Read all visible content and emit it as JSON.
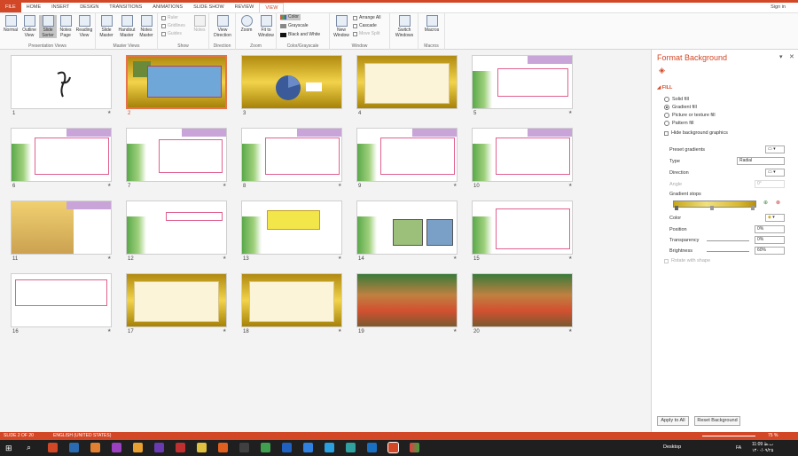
{
  "tabs": [
    "FILE",
    "HOME",
    "INSERT",
    "DESIGN",
    "TRANSITIONS",
    "ANIMATIONS",
    "SLIDE SHOW",
    "REVIEW",
    "VIEW"
  ],
  "signin": "Sign in",
  "ribbon": {
    "presentation_views": [
      "Normal",
      "Outline View",
      "Slide Sorter",
      "Notes Page",
      "Reading View"
    ],
    "presentation_views_label": "Presentation Views",
    "master_views": [
      "Slide Master",
      "Handout Master",
      "Notes Master"
    ],
    "master_views_label": "Master Views",
    "show": [
      "Ruler",
      "Gridlines",
      "Guides"
    ],
    "notes": "Notes",
    "show_label": "Show",
    "view_direction": "View Direction",
    "direction_label": "Direction",
    "zoom": "Zoom",
    "fit_to_window": "Fit to Window",
    "zoom_label": "Zoom",
    "color_opts": [
      "Color",
      "Grayscale",
      "Black and White"
    ],
    "color_label": "Color/Grayscale",
    "new_window": "New Window",
    "window_opts": [
      "Arrange All",
      "Cascade",
      "Move Split"
    ],
    "switch_windows": "Switch Windows",
    "window_label": "Window",
    "macros": "Macros",
    "macros_label": "Macros"
  },
  "slides": [
    "1",
    "2",
    "3",
    "4",
    "5",
    "6",
    "7",
    "8",
    "9",
    "10",
    "11",
    "12",
    "13",
    "14",
    "15",
    "16",
    "17",
    "18",
    "19",
    "20"
  ],
  "selected_slide": 2,
  "pane": {
    "title": "Format Background",
    "fill_section": "FILL",
    "fill_opts": [
      "Solid fill",
      "Gradient fill",
      "Picture or texture fill",
      "Pattern fill"
    ],
    "selected_fill": "Gradient fill",
    "hide_bg": "Hide background graphics",
    "preset": "Preset gradients",
    "type_label": "Type",
    "type_value": "Radial",
    "direction": "Direction",
    "angle": "Angle",
    "angle_value": "0°",
    "gradient_stops": "Gradient stops",
    "color": "Color",
    "position": "Position",
    "position_value": "0%",
    "transparency": "Transparency",
    "transparency_value": "0%",
    "brightness": "Brightness",
    "brightness_value": "60%",
    "rotate": "Rotate with shape",
    "apply_all": "Apply to All",
    "reset": "Reset Background"
  },
  "status": {
    "slide": "SLIDE 2 OF 20",
    "lang": "ENGLISH (UNITED STATES)",
    "zoom": "75 %"
  },
  "taskbar": {
    "desktop": "Desktop",
    "time": "11:09 ب.ظ",
    "date": "۱۴۰۰/۰۹/۲۵",
    "lang": "FA"
  },
  "colors": {
    "accent": "#d24726",
    "gold": "#d4b020",
    "taskbar": "#1f1f1f"
  }
}
